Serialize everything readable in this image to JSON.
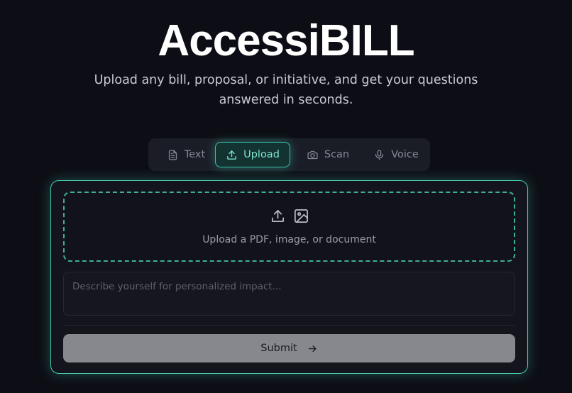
{
  "header": {
    "title": "AccessiBILL",
    "subtitle": "Upload any bill, proposal, or initiative, and get your questions answered in seconds."
  },
  "tabs": [
    {
      "label": "Text",
      "icon": "document-icon",
      "active": false
    },
    {
      "label": "Upload",
      "icon": "upload-icon",
      "active": true
    },
    {
      "label": "Scan",
      "icon": "camera-icon",
      "active": false
    },
    {
      "label": "Voice",
      "icon": "microphone-icon",
      "active": false
    }
  ],
  "upload": {
    "prompt": "Upload a PDF, image, or document",
    "icons": [
      "upload-icon",
      "image-icon"
    ]
  },
  "describe": {
    "placeholder": "Describe yourself for personalized impact...",
    "value": ""
  },
  "submit": {
    "label": "Submit",
    "icon": "arrow-right-icon"
  },
  "colors": {
    "background": "#0d0e15",
    "accent": "#3cc2a8",
    "submit_bg": "#87888d"
  }
}
